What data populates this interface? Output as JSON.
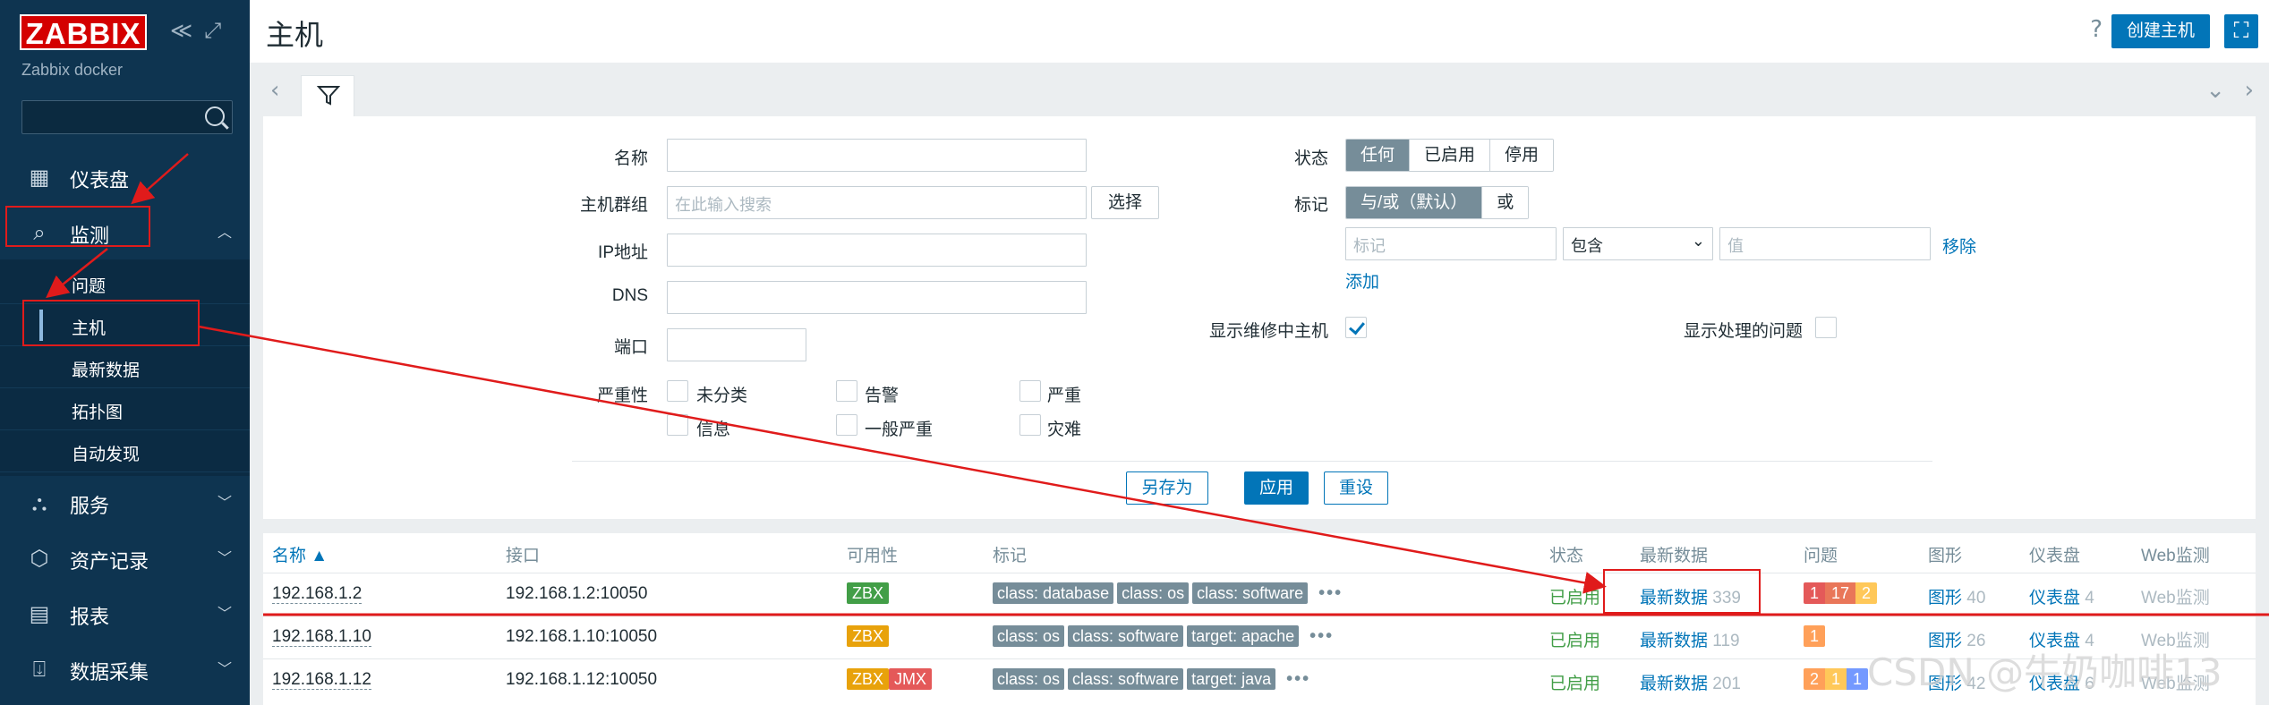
{
  "sidebar": {
    "logo": "ZABBIX",
    "subtitle": "Zabbix docker",
    "collapse_icons": [
      "≪",
      "⤢"
    ],
    "search": {
      "placeholder": ""
    },
    "items": [
      {
        "label": "仪表盘",
        "icon": "dashboard-icon"
      },
      {
        "label": "监测",
        "icon": "monitoring-icon",
        "expanded": true
      },
      {
        "label": "服务",
        "icon": "services-icon"
      },
      {
        "label": "资产记录",
        "icon": "inventory-icon"
      },
      {
        "label": "报表",
        "icon": "reports-icon"
      },
      {
        "label": "数据采集",
        "icon": "data-collection-icon"
      }
    ],
    "monitoring_sub": [
      {
        "label": "问题"
      },
      {
        "label": "主机",
        "active": true
      },
      {
        "label": "最新数据"
      },
      {
        "label": "拓扑图"
      },
      {
        "label": "自动发现"
      }
    ]
  },
  "header": {
    "title": "主机",
    "help": "?",
    "create_button": "创建主机"
  },
  "filter": {
    "name_label": "名称",
    "name_value": "",
    "hostgroup_label": "主机群组",
    "hostgroup_placeholder": "在此输入搜索",
    "select_button": "选择",
    "ip_label": "IP地址",
    "dns_label": "DNS",
    "port_label": "端口",
    "severity_label": "严重性",
    "severities": [
      "未分类",
      "告警",
      "严重",
      "信息",
      "一般严重",
      "灾难"
    ],
    "status_label": "状态",
    "status_options": [
      "任何",
      "已启用",
      "停用"
    ],
    "status_selected": "任何",
    "tags_label": "标记",
    "tags_mode_options": [
      "与/或（默认）",
      "或"
    ],
    "tag_placeholder": "标记",
    "tag_operator": "包含",
    "tag_value_placeholder": "值",
    "remove_link": "移除",
    "add_link": "添加",
    "show_maintenance_label": "显示维修中主机",
    "show_maintenance_checked": true,
    "show_suppressed_label": "显示处理的问题",
    "show_suppressed_checked": false,
    "save_as": "另存为",
    "apply": "应用",
    "reset": "重设"
  },
  "table": {
    "headers": [
      "名称 ▲",
      "接口",
      "可用性",
      "标记",
      "状态",
      "最新数据",
      "问题",
      "图形",
      "仪表盘",
      "Web监测"
    ],
    "rows": [
      {
        "name": "192.168.1.2",
        "interface": "192.168.1.2:10050",
        "availability": [
          {
            "text": "ZBX",
            "color": "#429e47"
          }
        ],
        "tags": [
          "class: database",
          "class: os",
          "class: software"
        ],
        "status": "已启用",
        "latest_label": "最新数据",
        "latest_count": "339",
        "problems": [
          {
            "text": "1",
            "color": "#e45959"
          },
          {
            "text": "17",
            "color": "#e97659"
          },
          {
            "text": "2",
            "color": "#ffc859"
          }
        ],
        "graphs_label": "图形",
        "graphs_count": "40",
        "dash_label": "仪表盘",
        "dash_count": "4",
        "web": "Web监测"
      },
      {
        "name": "192.168.1.10",
        "interface": "192.168.1.10:10050",
        "availability": [
          {
            "text": "ZBX",
            "color": "#e8a20b"
          }
        ],
        "tags": [
          "class: os",
          "class: software",
          "target: apache"
        ],
        "status": "已启用",
        "latest_label": "最新数据",
        "latest_count": "119",
        "problems": [
          {
            "text": "1",
            "color": "#ffa059"
          }
        ],
        "graphs_label": "图形",
        "graphs_count": "26",
        "dash_label": "仪表盘",
        "dash_count": "4",
        "web": "Web监测"
      },
      {
        "name": "192.168.1.12",
        "interface": "192.168.1.12:10050",
        "availability": [
          {
            "text": "ZBX",
            "color": "#e8a20b"
          },
          {
            "text": "JMX",
            "color": "#e45959"
          }
        ],
        "tags": [
          "class: os",
          "class: software",
          "target: java"
        ],
        "status": "已启用",
        "latest_label": "最新数据",
        "latest_count": "201",
        "problems": [
          {
            "text": "2",
            "color": "#ffa059"
          },
          {
            "text": "1",
            "color": "#ffc859"
          },
          {
            "text": "1",
            "color": "#7499ff"
          }
        ],
        "graphs_label": "图形",
        "graphs_count": "42",
        "dash_label": "仪表盘",
        "dash_count": "6",
        "web": "Web监测"
      }
    ]
  },
  "annotation_color": "#e01b1b",
  "watermark": "CSDN @牛奶咖啡13"
}
